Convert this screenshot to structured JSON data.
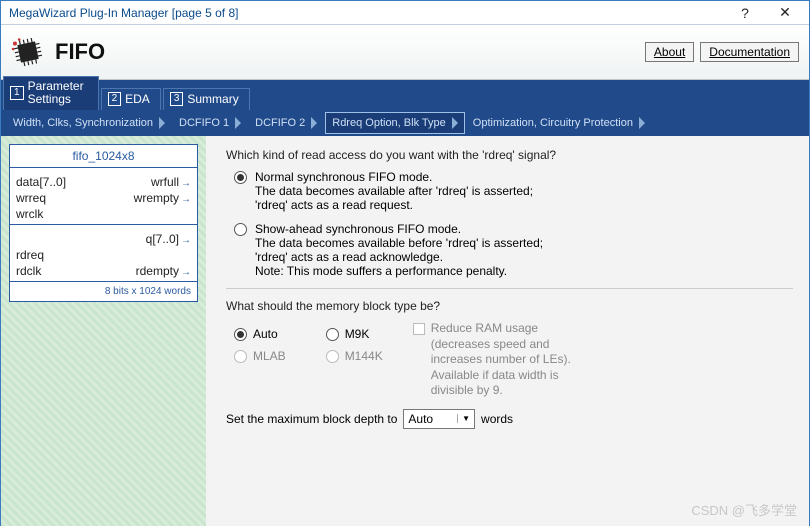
{
  "window": {
    "title": "MegaWizard Plug-In Manager [page 5 of 8]"
  },
  "header": {
    "title": "FIFO",
    "about": "About",
    "docs": "Documentation"
  },
  "tabs": {
    "t1_num": "1",
    "t1": "Parameter Settings",
    "t2_num": "2",
    "t2": "EDA",
    "t3_num": "3",
    "t3": "Summary"
  },
  "subtabs": {
    "a": "Width, Clks, Synchronization",
    "b": "DCFIFO 1",
    "c": "DCFIFO 2",
    "d": "Rdreq Option, Blk Type",
    "e": "Optimization, Circuitry Protection"
  },
  "block": {
    "name": "fifo_1024x8",
    "p1l": "data[7..0]",
    "p1r": "wrfull",
    "p2l": "wrreq",
    "p2r": "wrempty",
    "p3l": "wrclk",
    "p4r": "q[7..0]",
    "p5l": "rdreq",
    "p6l": "rdclk",
    "p6r": "rdempty",
    "foot": "8 bits x 1024 words"
  },
  "q1": {
    "title": "Which kind of read access do you want with the 'rdreq' signal?",
    "opt1_l1": "Normal synchronous FIFO mode.",
    "opt1_l2": "The data becomes available after 'rdreq' is asserted;",
    "opt1_l3": "'rdreq' acts as a read request.",
    "opt2_l1": "Show-ahead synchronous FIFO mode.",
    "opt2_l2": "The data becomes available before 'rdreq' is asserted;",
    "opt2_l3": "'rdreq' acts as a read acknowledge.",
    "opt2_l4": "Note: This mode suffers a performance penalty."
  },
  "q2": {
    "title": "What should the memory block type be?",
    "auto": "Auto",
    "m9k": "M9K",
    "mlab": "MLAB",
    "m144k": "M144K",
    "ramnote": "Reduce RAM usage (decreases speed and increases number of LEs).  Available if data width is divisible by 9.",
    "depth_label_a": "Set the maximum block depth to",
    "depth_val": "Auto",
    "depth_label_b": "words"
  },
  "watermark": "CSDN @飞多学堂"
}
